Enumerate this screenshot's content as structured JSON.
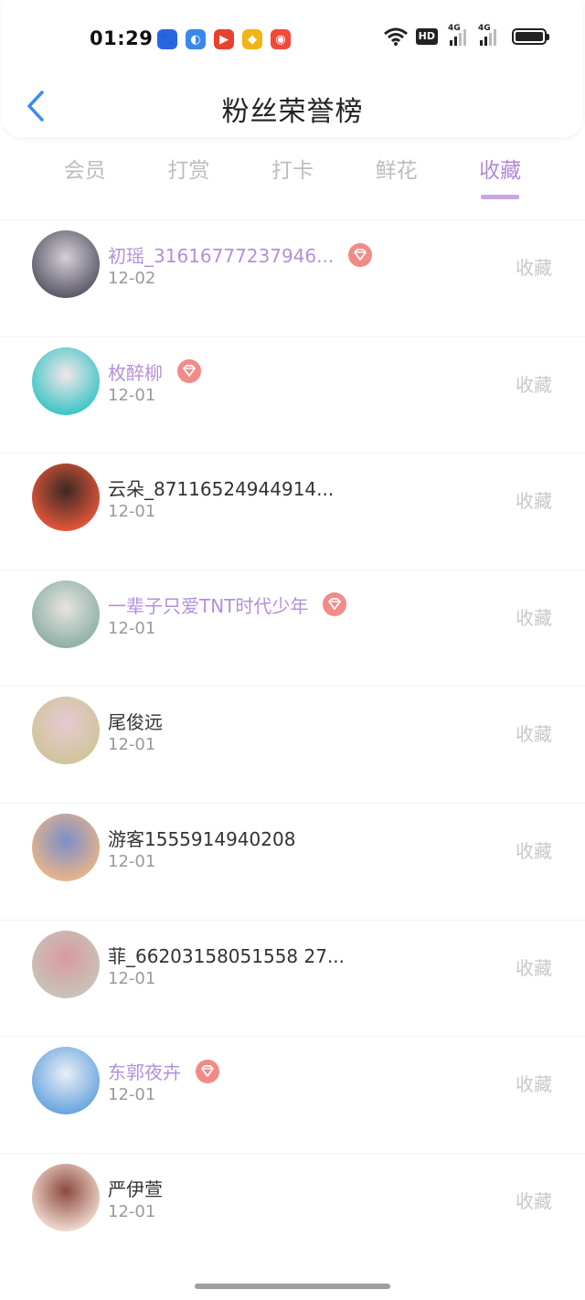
{
  "status": {
    "time": "01:29",
    "apps": [
      {
        "icon": "baidu-paw-icon",
        "color": "#2b64e3",
        "glyph": "🐾"
      },
      {
        "icon": "browser-icon",
        "color": "#3a88e8",
        "glyph": "◐"
      },
      {
        "icon": "video-play-icon",
        "color": "#e8412c",
        "glyph": "▶"
      },
      {
        "icon": "diamond-app-icon",
        "color": "#f1b417",
        "glyph": "◆"
      },
      {
        "icon": "weibo-icon",
        "color": "#f04a3a",
        "glyph": "◉"
      }
    ],
    "hd": "HD",
    "sig1_label": "4G",
    "sig2_label": "4G"
  },
  "header": {
    "title": "粉丝荣誉榜"
  },
  "tabs": [
    {
      "label": "会员",
      "active": false
    },
    {
      "label": "打赏",
      "active": false
    },
    {
      "label": "打卡",
      "active": false
    },
    {
      "label": "鲜花",
      "active": false
    },
    {
      "label": "收藏",
      "active": true
    }
  ],
  "rows": [
    {
      "name": "初瑶_31616777237946...",
      "date": "12-02",
      "action": "收藏",
      "vip": true,
      "avatar_colors": [
        "#5a5a6a",
        "#d8cfd6"
      ]
    },
    {
      "name": "枚醉柳",
      "date": "12-01",
      "action": "收藏",
      "vip": true,
      "avatar_colors": [
        "#3ec6c7",
        "#f4e6ea"
      ]
    },
    {
      "name": "云朵_87116524944914...",
      "date": "12-01",
      "action": "收藏",
      "vip": false,
      "avatar_colors": [
        "#e2553a",
        "#3b2a24"
      ]
    },
    {
      "name": "一辈子只爱TNT时代少年",
      "date": "12-01",
      "action": "收藏",
      "vip": true,
      "avatar_colors": [
        "#8fb0a9",
        "#e8e4df"
      ]
    },
    {
      "name": "尾俊远",
      "date": "12-01",
      "action": "收藏",
      "vip": false,
      "avatar_colors": [
        "#cfc59a",
        "#e8c9d3"
      ]
    },
    {
      "name": "游客1555914940208",
      "date": "12-01",
      "action": "收藏",
      "vip": false,
      "avatar_colors": [
        "#e7b48a",
        "#7a8fc9"
      ]
    },
    {
      "name": "菲_66203158051558 27...",
      "date": "12-01",
      "action": "收藏",
      "vip": false,
      "avatar_colors": [
        "#c8c3b8",
        "#d99aa0"
      ]
    },
    {
      "name": "东郭夜卉",
      "date": "12-01",
      "action": "收藏",
      "vip": true,
      "avatar_colors": [
        "#6aa6de",
        "#e9eef6"
      ]
    },
    {
      "name": "严伊萱",
      "date": "12-01",
      "action": "收藏",
      "vip": false,
      "avatar_colors": [
        "#f0d7cd",
        "#8c4a3e"
      ]
    }
  ]
}
